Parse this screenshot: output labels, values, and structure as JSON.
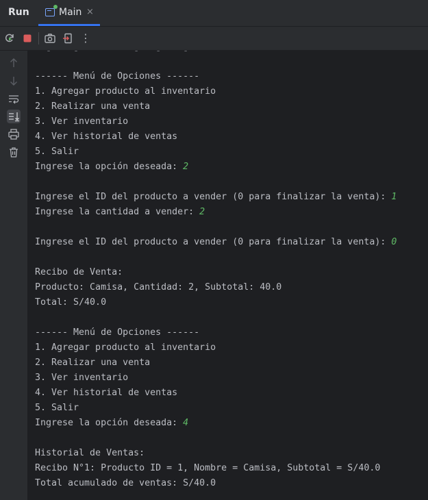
{
  "tabbar": {
    "run_label": "Run",
    "tab_label": "Main",
    "tab_close": "×"
  },
  "toolbar": {
    "buttons": [
      "rerun-icon",
      "stop-icon",
      "camera-icon",
      "exit-icon",
      "more-icon"
    ],
    "more_label": "⋮"
  },
  "sidebar": {
    "icons": [
      "arrow-up-icon",
      "arrow-down-icon",
      "soft-wrap-icon",
      "scroll-to-end-icon",
      "print-icon",
      "trash-icon"
    ]
  },
  "console": {
    "lines": [
      {
        "text": "------ Menú de Opciones ------"
      },
      {
        "text": "1. Agregar producto al inventario"
      },
      {
        "text": "2. Realizar una venta"
      },
      {
        "text": "3. Ver inventario"
      },
      {
        "text": "4. Ver historial de ventas"
      },
      {
        "text": "5. Salir"
      },
      {
        "text": "Ingrese la opción deseada: ",
        "input": "2"
      },
      {
        "text": ""
      },
      {
        "text": "Ingrese el ID del producto a vender (0 para finalizar la venta): ",
        "input": "1"
      },
      {
        "text": "Ingrese la cantidad a vender: ",
        "input": "2"
      },
      {
        "text": ""
      },
      {
        "text": "Ingrese el ID del producto a vender (0 para finalizar la venta): ",
        "input": "0"
      },
      {
        "text": ""
      },
      {
        "text": "Recibo de Venta:"
      },
      {
        "text": "Producto: Camisa, Cantidad: 2, Subtotal: 40.0"
      },
      {
        "text": "Total: S/40.0"
      },
      {
        "text": ""
      },
      {
        "text": "------ Menú de Opciones ------"
      },
      {
        "text": "1. Agregar producto al inventario"
      },
      {
        "text": "2. Realizar una venta"
      },
      {
        "text": "3. Ver inventario"
      },
      {
        "text": "4. Ver historial de ventas"
      },
      {
        "text": "5. Salir"
      },
      {
        "text": "Ingrese la opción deseada: ",
        "input": "4"
      },
      {
        "text": ""
      },
      {
        "text": "Historial de Ventas:"
      },
      {
        "text": "Recibo N°1: Producto ID = 1, Nombre = Camisa, Subtotal = S/40.0"
      },
      {
        "text": "Total acumulado de ventas: S/40.0"
      }
    ]
  }
}
